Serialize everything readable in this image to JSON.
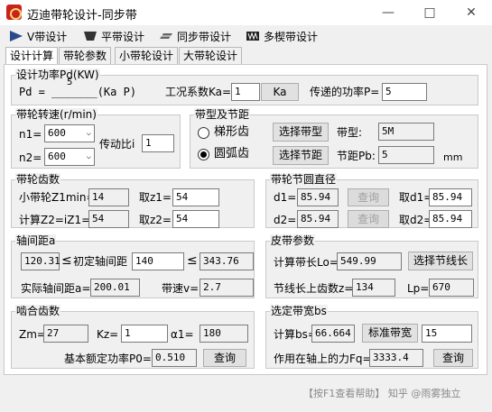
{
  "window": {
    "title": "迈迪带轮设计-同步带",
    "minimize": "—",
    "maximize": "□",
    "close": "✕"
  },
  "toolbar": {
    "items": [
      {
        "label": "V带设计",
        "icon": "v-belt-icon"
      },
      {
        "label": "平带设计",
        "icon": "flat-belt-icon"
      },
      {
        "label": "同步带设计",
        "icon": "sync-belt-icon"
      },
      {
        "label": "多楔带设计",
        "icon": "multi-v-belt-icon"
      }
    ]
  },
  "tabs": [
    "设计计算",
    "带轮参数",
    "小带轮设计",
    "大带轮设计"
  ],
  "power": {
    "title": "设计功率Pd(KW)",
    "formula_left": "Pd = _______(Ka P)",
    "formula_value": "5",
    "ka_label": "工况系数Ka=",
    "ka_value": "1",
    "ka_button": "Ka",
    "p_label": "传递的功率P=",
    "p_value": "5"
  },
  "speed": {
    "title": "带轮转速(r/min)",
    "n1_label": "n1=",
    "n1_value": "600",
    "n2_label": "n2=",
    "n2_value": "600",
    "ratio_label": "传动比i",
    "ratio_value": "1"
  },
  "belt_type": {
    "title": "带型及节距",
    "opt_trapezoid": "梯形齿",
    "opt_arc": "圆弧齿",
    "select_type_btn": "选择带型",
    "select_pitch_btn": "选择节距",
    "type_label": "带型:",
    "type_value": "5M",
    "pitch_label": "节距Pb:",
    "pitch_value": "5",
    "pitch_unit": "mm"
  },
  "teeth": {
    "title": "带轮齿数",
    "zmin_label": "小带轮Z1min=",
    "zmin_value": "14",
    "z1_label": "取z1=",
    "z1_value": "54",
    "z2calc_label": "计算Z2=iZ1=",
    "z2calc_value": "54",
    "z2_label": "取z2=",
    "z2_value": "54"
  },
  "pitch_dia": {
    "title": "带轮节圆直径",
    "d1_label": "d1=",
    "d1_value": "85.94",
    "d2_label": "d2=",
    "d2_value": "85.94",
    "query1": "查询",
    "query2": "查询",
    "take_d1_label": "取d1=",
    "take_d1_value": "85.94",
    "take_d2_label": "取d2=",
    "take_d2_value": "85.94"
  },
  "center": {
    "title": "轴间距a",
    "min_value": "120.31",
    "lt1": "≤",
    "init_label": "初定轴间距",
    "init_value": "140",
    "lt2": "≤",
    "max_value": "343.76",
    "actual_label": "实际轴间距a=",
    "actual_value": "200.01",
    "speed_label": "带速v=",
    "speed_value": "2.7"
  },
  "belt_params": {
    "title": "皮带参数",
    "length_label": "计算带长Lo=",
    "length_value": "549.99",
    "select_length_btn": "选择节线长",
    "teeth_label": "节线长上齿数z=",
    "teeth_value": "134",
    "lp_label": "Lp=",
    "lp_value": "670"
  },
  "mesh": {
    "title": "啮合齿数",
    "zm_label": "Zm=",
    "zm_value": "27",
    "kz_label": "Kz=",
    "kz_value": "1",
    "alpha_label": "α1=",
    "alpha_value": "180",
    "p0_label": "基本额定功率P0=",
    "p0_value": "0.510",
    "query": "查询"
  },
  "width": {
    "title": "选定带宽bs",
    "calc_label": "计算bs=",
    "calc_value": "66.664",
    "std_btn": "标准带宽",
    "std_value": "15",
    "force_label": "作用在轴上的力Fq=",
    "force_value": "3333.4",
    "query": "查询"
  },
  "watermark": "【按F1查看帮助】 知乎 @雨雾独立"
}
